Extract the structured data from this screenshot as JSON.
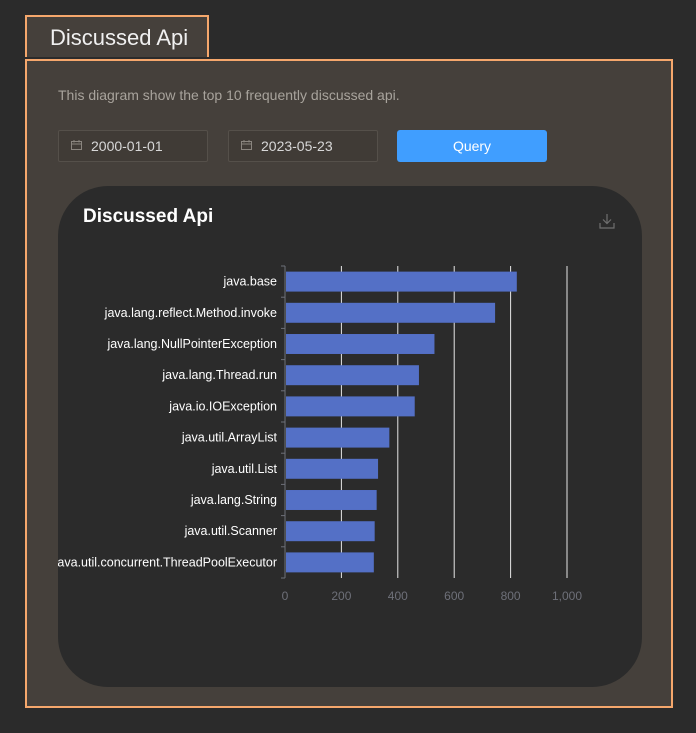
{
  "tab": {
    "title": "Discussed Api"
  },
  "panel": {
    "description": "This diagram show the top 10 frequently discussed api.",
    "start_date": "2000-01-01",
    "end_date": "2023-05-23",
    "query_label": "Query",
    "calendar_icon": "calendar-icon",
    "download_icon": "download-icon"
  },
  "colors": {
    "accent": "#f5a76c",
    "bar": "#5470c6",
    "button": "#409eff"
  },
  "chart_data": {
    "type": "bar",
    "orientation": "horizontal",
    "title": "Discussed Api",
    "categories": [
      "java.base",
      "java.lang.reflect.Method.invoke",
      "java.lang.NullPointerException",
      "java.lang.Thread.run",
      "java.io.IOException",
      "java.util.ArrayList",
      "java.util.List",
      "java.lang.String",
      "java.util.Scanner",
      "java.util.concurrent.ThreadPoolExecutor"
    ],
    "values": [
      822,
      745,
      530,
      475,
      460,
      370,
      330,
      325,
      318,
      315
    ],
    "xlim": [
      0,
      1000
    ],
    "xticks": [
      "0",
      "200",
      "400",
      "600",
      "800",
      "1,000"
    ],
    "grid": true
  }
}
